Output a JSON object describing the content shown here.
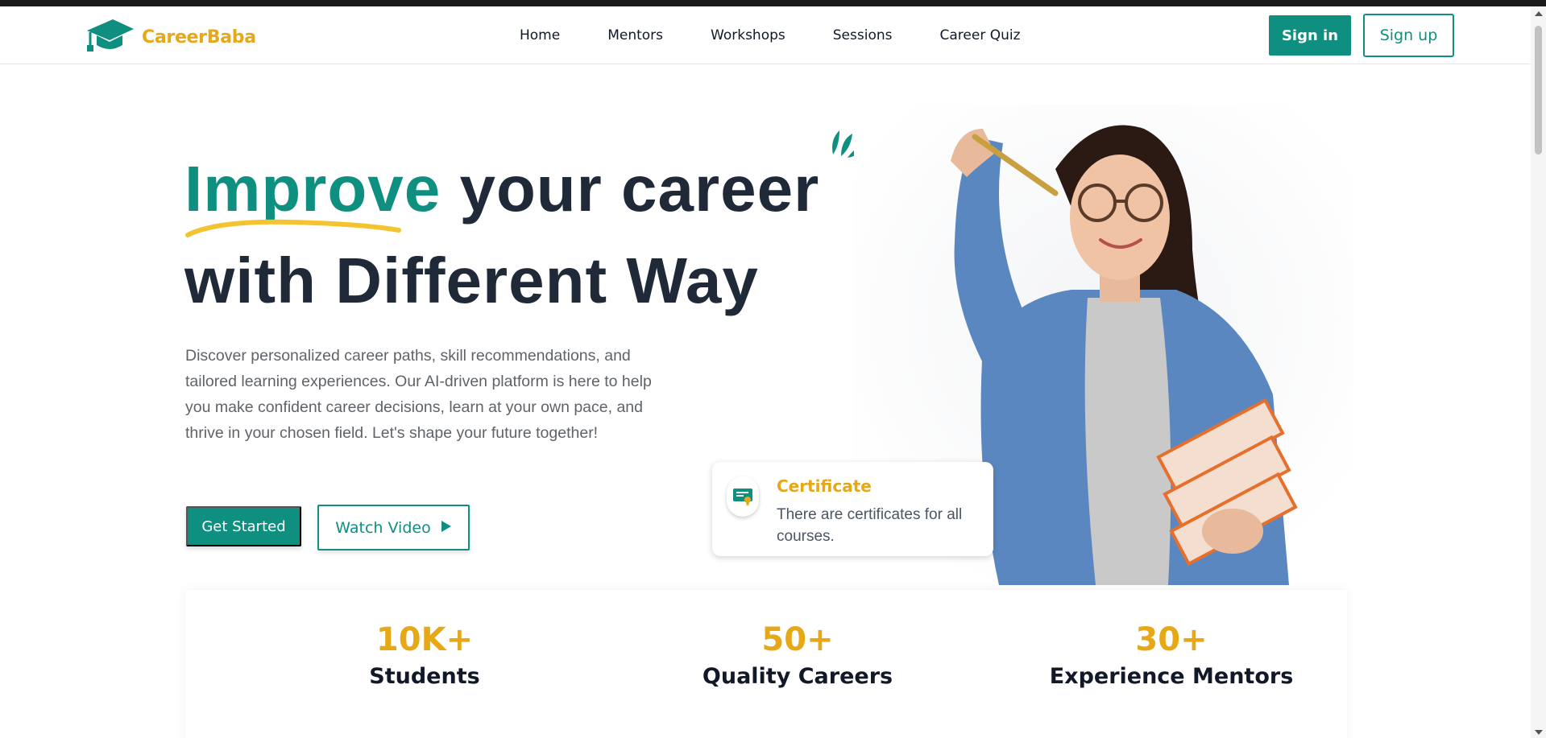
{
  "app": {
    "brand": "CareerBaba",
    "logo_icon": "graduation-cap-icon",
    "colors": {
      "primary": "#0e8f80",
      "accent": "#e6a817",
      "text_dark": "#1f2937",
      "text_muted": "#5f6368"
    }
  },
  "nav": {
    "links": [
      "Home",
      "Mentors",
      "Workshops",
      "Sessions",
      "Career Quiz"
    ],
    "signin_label": "Sign in",
    "signup_label": "Sign up"
  },
  "hero": {
    "title_accent": "Improve",
    "title_rest_line1": " your career",
    "title_line2": "with Different Way",
    "description": "Discover personalized career paths, skill recommendations, and tailored learning experiences. Our AI-driven platform is here to help you make confident career decisions, learn at your own pace, and thrive in your chosen field. Let's shape your future together!",
    "get_started_label": "Get Started",
    "watch_video_label": "Watch Video",
    "watch_video_icon": "play-icon"
  },
  "certificate_card": {
    "icon": "certificate-icon",
    "title": "Certificate",
    "text": "There are certificates for all courses."
  },
  "stats": [
    {
      "number": "10K+",
      "label": "Students"
    },
    {
      "number": "50+",
      "label": "Quality Careers"
    },
    {
      "number": "30+",
      "label": "Experience Mentors"
    }
  ]
}
